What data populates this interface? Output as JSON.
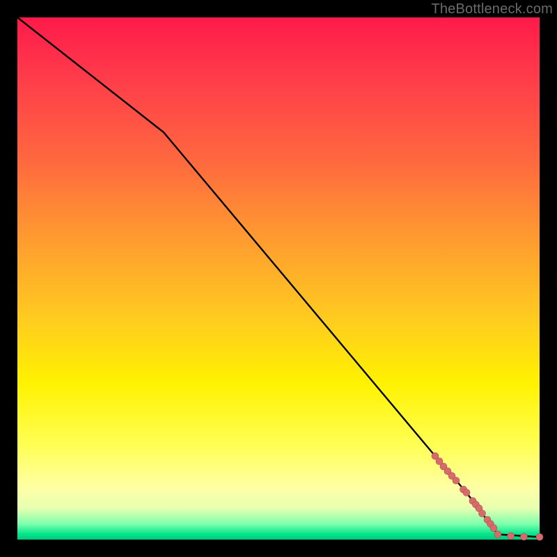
{
  "watermark": "TheBottleneck.com",
  "colors": {
    "line": "#000000",
    "marker_fill": "#d66b6b",
    "marker_stroke": "#b44d4d"
  },
  "chart_data": {
    "type": "line",
    "title": "",
    "xlabel": "",
    "ylabel": "",
    "xlim": [
      0,
      100
    ],
    "ylim": [
      0,
      100
    ],
    "series": [
      {
        "name": "curve",
        "x": [
          0,
          28,
          80,
          86,
          89,
          92,
          100
        ],
        "y": [
          100,
          78,
          16,
          9,
          5,
          1,
          0.5
        ]
      }
    ],
    "markers": [
      {
        "x": 80.0,
        "y": 16.0,
        "r": 5
      },
      {
        "x": 80.8,
        "y": 15.0,
        "r": 5
      },
      {
        "x": 81.6,
        "y": 14.0,
        "r": 5
      },
      {
        "x": 82.4,
        "y": 13.1,
        "r": 5
      },
      {
        "x": 83.2,
        "y": 12.2,
        "r": 5
      },
      {
        "x": 84.0,
        "y": 11.3,
        "r": 5
      },
      {
        "x": 85.4,
        "y": 9.6,
        "r": 5
      },
      {
        "x": 86.0,
        "y": 9.0,
        "r": 5
      },
      {
        "x": 87.2,
        "y": 7.4,
        "r": 5
      },
      {
        "x": 87.8,
        "y": 6.7,
        "r": 5
      },
      {
        "x": 88.4,
        "y": 6.0,
        "r": 5
      },
      {
        "x": 89.0,
        "y": 5.0,
        "r": 5
      },
      {
        "x": 90.0,
        "y": 3.8,
        "r": 5
      },
      {
        "x": 90.6,
        "y": 3.0,
        "r": 5
      },
      {
        "x": 91.2,
        "y": 2.2,
        "r": 5
      },
      {
        "x": 92.0,
        "y": 1.0,
        "r": 5
      },
      {
        "x": 94.5,
        "y": 0.7,
        "r": 5
      },
      {
        "x": 97.0,
        "y": 0.55,
        "r": 5
      },
      {
        "x": 100.0,
        "y": 0.5,
        "r": 5
      }
    ]
  }
}
